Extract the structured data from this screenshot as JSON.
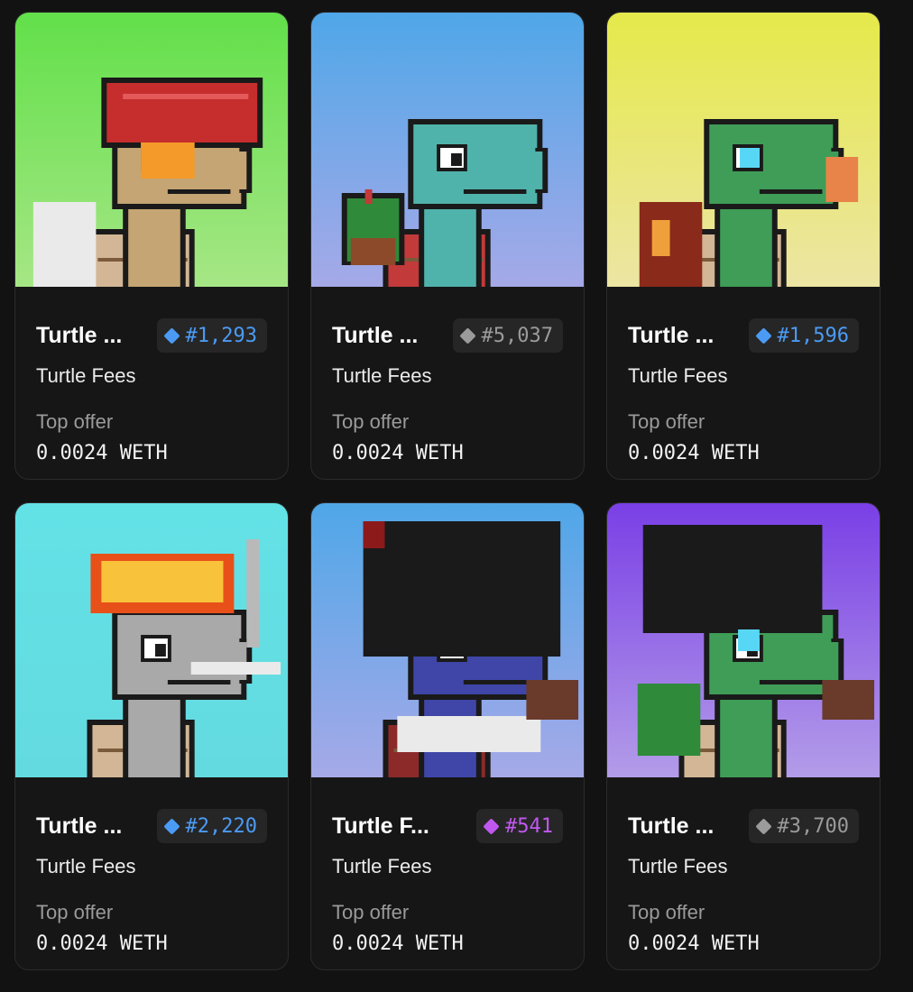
{
  "cards": [
    {
      "name": "Turtle ...",
      "rank": "#1,293",
      "rank_color": "#4b9bf5",
      "collection": "Turtle Fees",
      "offer_label": "Top offer",
      "offer_value": "0.0024 WETH",
      "bg_top": "#62e04a",
      "bg_bottom": "#a6e685",
      "turtle_color": "#c4a573",
      "shell_color": "#d2b695",
      "accessory": "red-helmet",
      "icon": "diamond-icon"
    },
    {
      "name": "Turtle ...",
      "rank": "#5,037",
      "rank_color": "#9b9b9b",
      "collection": "Turtle Fees",
      "offer_label": "Top offer",
      "offer_value": "0.0024 WETH",
      "bg_top": "#4fa7e8",
      "bg_bottom": "#a6a9e8",
      "turtle_color": "#4fb3ab",
      "shell_color": "#c23a3a",
      "accessory": "plant",
      "icon": "diamond-icon"
    },
    {
      "name": "Turtle ...",
      "rank": "#1,596",
      "rank_color": "#4b9bf5",
      "collection": "Turtle Fees",
      "offer_label": "Top offer",
      "offer_value": "0.0024 WETH",
      "bg_top": "#e6e94a",
      "bg_bottom": "#ece5a4",
      "turtle_color": "#3f9d57",
      "shell_color": "#d2b695",
      "accessory": "diamond-eye",
      "icon": "diamond-icon"
    },
    {
      "name": "Turtle ...",
      "rank": "#2,220",
      "rank_color": "#4b9bf5",
      "collection": "Turtle Fees",
      "offer_label": "Top offer",
      "offer_value": "0.0024 WETH",
      "bg_top": "#63e2e6",
      "bg_bottom": "#63dae0",
      "turtle_color": "#a9a9a9",
      "shell_color": "#d2b695",
      "accessory": "fire-hair",
      "icon": "diamond-icon"
    },
    {
      "name": "Turtle F...",
      "rank": "#541",
      "rank_color": "#c058f0",
      "collection": "Turtle Fees",
      "offer_label": "Top offer",
      "offer_value": "0.0024 WETH",
      "bg_top": "#4fa7e8",
      "bg_bottom": "#a6a9e8",
      "turtle_color": "#3f46a8",
      "shell_color": "#8c2a2a",
      "accessory": "afro",
      "icon": "diamond-icon"
    },
    {
      "name": "Turtle ...",
      "rank": "#3,700",
      "rank_color": "#9b9b9b",
      "collection": "Turtle Fees",
      "offer_label": "Top offer",
      "offer_value": "0.0024 WETH",
      "bg_top": "#7a3fe6",
      "bg_bottom": "#b39ce8",
      "turtle_color": "#3f9d57",
      "shell_color": "#d2b695",
      "accessory": "spiky-hair",
      "icon": "diamond-icon"
    }
  ]
}
